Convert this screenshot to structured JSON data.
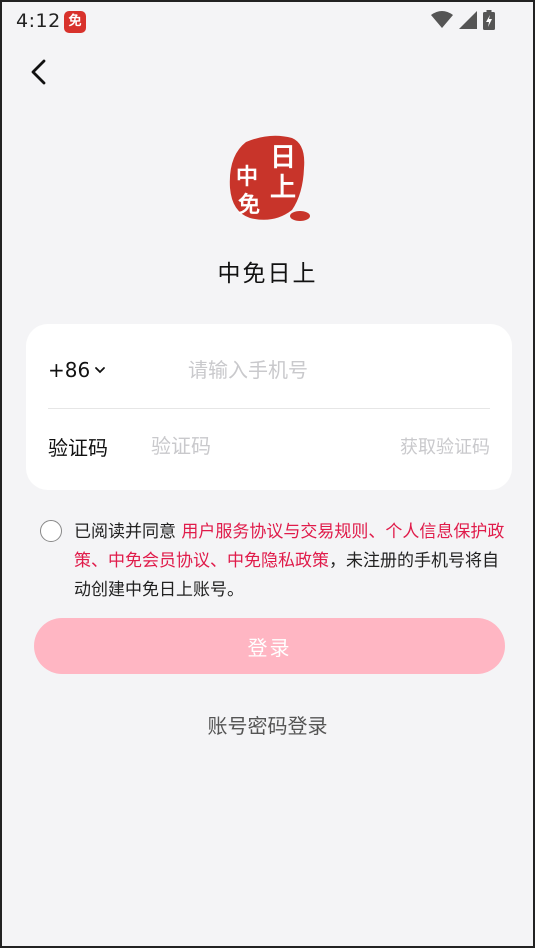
{
  "status_bar": {
    "time": "4:12",
    "app_icon_text": "免"
  },
  "app": {
    "name": "中免日上",
    "logo_chars": [
      "日",
      "上",
      "中",
      "免"
    ],
    "logo_color": "#c8342a"
  },
  "form": {
    "country_code": "+86",
    "phone_placeholder": "请输入手机号",
    "code_label": "验证码",
    "code_placeholder": "验证码",
    "get_code_label": "获取验证码"
  },
  "agreement": {
    "prefix": "已阅读并同意 ",
    "link_terms": "用户服务协议与交易规则",
    "sep1": "、",
    "link_privacy": "个人信息保护政策",
    "sep2": "、",
    "link_member": "中免会员协议",
    "sep3": "、",
    "link_hidden_privacy": "中免隐私政策",
    "suffix": "，未注册的手机号将自动创建中免日上账号。"
  },
  "actions": {
    "login_label": "登录",
    "password_login_label": "账号密码登录"
  },
  "colors": {
    "accent": "#e01b4a",
    "button_disabled": "#ffb6c3",
    "background": "#f4f4f6"
  }
}
